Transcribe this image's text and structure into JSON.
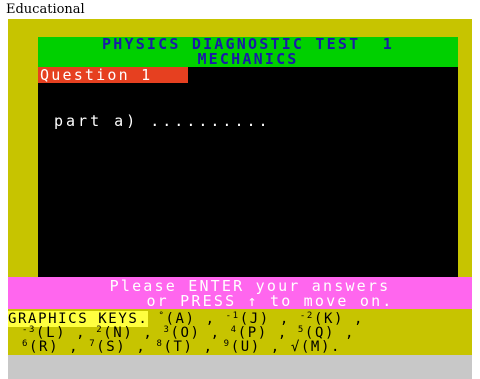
{
  "caption": "Educational",
  "colors": {
    "border": "#c7c400",
    "title_bg": "#00d000",
    "title_text": "#1a1aa8",
    "question_bg": "#e64020",
    "prompt_bg": "#ff66ee",
    "keys_heading_bg": "#ffff40",
    "footer_bg": "#c8c8c8"
  },
  "title": {
    "line1": "PHYSICS DIAGNOSTIC TEST  1",
    "line2": "MECHANICS"
  },
  "question": {
    "label": "Question 1",
    "part": "part a) .........."
  },
  "prompt": {
    "line1": "Please ENTER your answers",
    "line2": "or PRESS ↑ to move on."
  },
  "graphics_keys": {
    "heading": "GRAPHICS KEYS.",
    "row1": [
      {
        "sym": "°",
        "key": "(A) ,"
      },
      {
        "sym": "-1",
        "key": "(J) ,"
      },
      {
        "sym": "-2",
        "key": "(K) ,"
      }
    ],
    "row2": [
      {
        "sym": "-3",
        "key": "(L) ,"
      },
      {
        "sym": "2",
        "key": "(N) ,"
      },
      {
        "sym": "3",
        "key": "(O) ,"
      },
      {
        "sym": "4",
        "key": "(P) ,"
      },
      {
        "sym": "5",
        "key": "(Q) ,"
      }
    ],
    "row3": [
      {
        "sym": "6",
        "key": "(R) ,"
      },
      {
        "sym": "7",
        "key": "(S) ,"
      },
      {
        "sym": "8",
        "key": "(T) ,"
      },
      {
        "sym": "9",
        "key": "(U) ,"
      },
      {
        "sym": "√",
        "key": "(M)."
      }
    ]
  }
}
